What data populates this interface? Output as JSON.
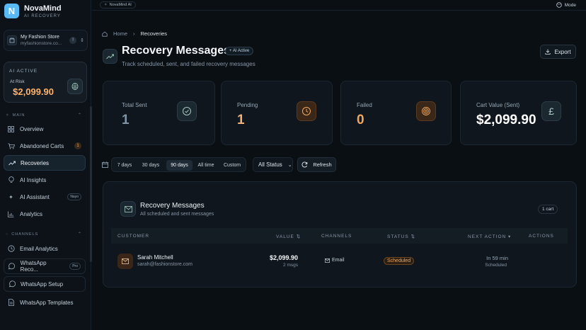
{
  "brand": {
    "name": "NovaMind",
    "sub": "AI RECOVERY",
    "logo_letter": "N"
  },
  "store": {
    "name": "My Fashion Store",
    "url": "myfashionstore.co...",
    "badge": "!"
  },
  "ai_card": {
    "status": "AI ACTIVE",
    "risk_label": "At Risk",
    "risk_value": "$2,099.90"
  },
  "nav_sections": {
    "main": "MAIN",
    "channels": "CHANNELS"
  },
  "nav": {
    "overview": "Overview",
    "abandoned": "Abandoned Carts",
    "abandoned_count": "1",
    "recoveries": "Recoveries",
    "insights": "AI Insights",
    "assistant": "AI Assistant",
    "assistant_tag": "Nayo",
    "analytics": "Analytics",
    "email_analytics": "Email Analytics",
    "whatsapp_reco": "WhatsApp Reco...",
    "whatsapp_reco_tag": "Pro",
    "whatsapp_setup": "WhatsApp Setup",
    "whatsapp_templates": "WhatsApp Templates"
  },
  "topbar": {
    "pill": "NovaMind AI",
    "mode": "Mode"
  },
  "breadcrumb": {
    "home": "Home",
    "sep": "›",
    "current": "Recoveries"
  },
  "page": {
    "title": "Recovery Messages",
    "ai_pill": "+ AI Active",
    "subtitle": "Track scheduled, sent, and failed recovery messages",
    "export": "Export"
  },
  "stats": [
    {
      "label": "Total Sent",
      "value": "1",
      "color": "#7f96a8"
    },
    {
      "label": "Pending",
      "value": "1",
      "color": "#f0b27a"
    },
    {
      "label": "Failed",
      "value": "0",
      "color": "#f0a860"
    },
    {
      "label": "Cart Value (Sent)",
      "value": "$2,099.90",
      "color": "#ffffff"
    }
  ],
  "filters": {
    "ranges": [
      "7 days",
      "30 days",
      "90 days",
      "All time",
      "Custom"
    ],
    "active_range": "90 days",
    "status": "All Status",
    "refresh": "Refresh"
  },
  "panel": {
    "title": "Recovery Messages",
    "subtitle": "All scheduled and sent messages",
    "count": "1 cart",
    "headers": {
      "customer": "CUSTOMER",
      "value": "VALUE ⇅",
      "channels": "CHANNELS",
      "status": "STATUS ⇅",
      "next": "NEXT ACTION ▾",
      "actions": "ACTIONS"
    },
    "rows": [
      {
        "name": "Sarah Mitchell",
        "email": "sarah@fashionstore.com",
        "value": "$2,099.90",
        "msgs": "2 msgs",
        "channel": "Email",
        "status": "Scheduled",
        "next": "In 59 min",
        "next_sub": "Scheduled"
      }
    ]
  }
}
